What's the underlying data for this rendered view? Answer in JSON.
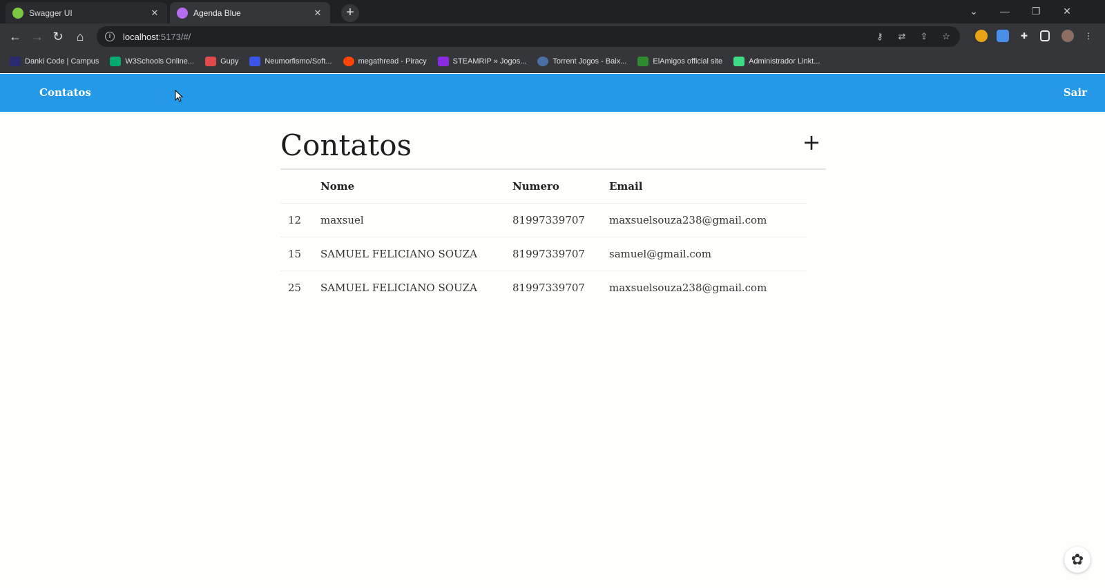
{
  "browser": {
    "tabs": [
      {
        "title": "Swagger UI",
        "favicon_color": "#7ac943",
        "active": false
      },
      {
        "title": "Agenda Blue",
        "favicon_color": "#b46cf0",
        "active": true
      }
    ],
    "address": {
      "host": "localhost",
      "path": ":5173/#/"
    },
    "bookmarks": [
      {
        "label": "Danki Code | Campus",
        "color": "#2a2a6e"
      },
      {
        "label": "W3Schools Online...",
        "color": "#04aa6d"
      },
      {
        "label": "Gupy",
        "color": "#e04a4a"
      },
      {
        "label": "Neumorfismo/Soft...",
        "color": "#3b55e6"
      },
      {
        "label": "megathread - Piracy",
        "color": "#ff4500"
      },
      {
        "label": "STEAMRIP » Jogos...",
        "color": "#8a2be2"
      },
      {
        "label": "Torrent Jogos - Baix...",
        "color": "#4a6fa5"
      },
      {
        "label": "ElAmigos official site",
        "color": "#2e8b2e"
      },
      {
        "label": "Administrador Linkt...",
        "color": "#3ddc84"
      }
    ]
  },
  "navbar": {
    "brand": "Contatos",
    "logout": "Sair",
    "background": "#2399e7"
  },
  "main": {
    "title": "Contatos",
    "add_icon": "+",
    "table": {
      "headers": [
        "",
        "Nome",
        "Numero",
        "Email"
      ],
      "rows": [
        {
          "id": "12",
          "nome": "maxsuel",
          "numero": "81997339707",
          "email": "maxsuelsouza238@gmail.com"
        },
        {
          "id": "15",
          "nome": "SAMUEL FELICIANO SOUZA",
          "numero": "81997339707",
          "email": "samuel@gmail.com"
        },
        {
          "id": "25",
          "nome": "SAMUEL FELICIANO SOUZA",
          "numero": "81997339707",
          "email": "maxsuelsouza238@gmail.com"
        }
      ]
    }
  }
}
